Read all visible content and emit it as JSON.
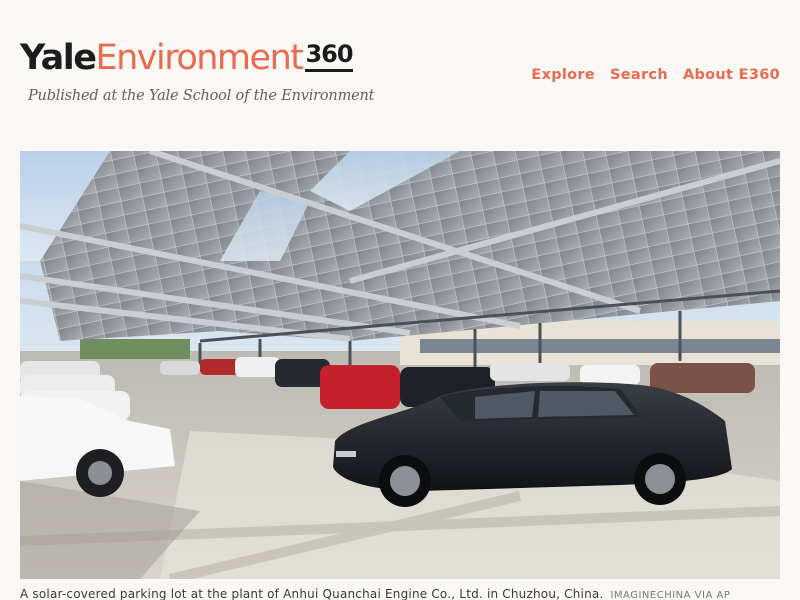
{
  "site": {
    "logo_yale": "Yale",
    "logo_environment": "Environment",
    "logo_360": "360",
    "tagline": "Published at the Yale School of the Environment"
  },
  "nav": {
    "items": [
      {
        "label": "Explore"
      },
      {
        "label": "Search"
      },
      {
        "label": "About E360"
      }
    ]
  },
  "hero": {
    "caption": "A solar-covered parking lot at the plant of Anhui Quanchai Engine Co., Ltd. in Chuzhou, China.",
    "credit": "IMAGINECHINA VIA AP"
  },
  "colors": {
    "accent": "#ea6a4f",
    "text": "#1c1c1c",
    "background": "#faf8f4"
  }
}
